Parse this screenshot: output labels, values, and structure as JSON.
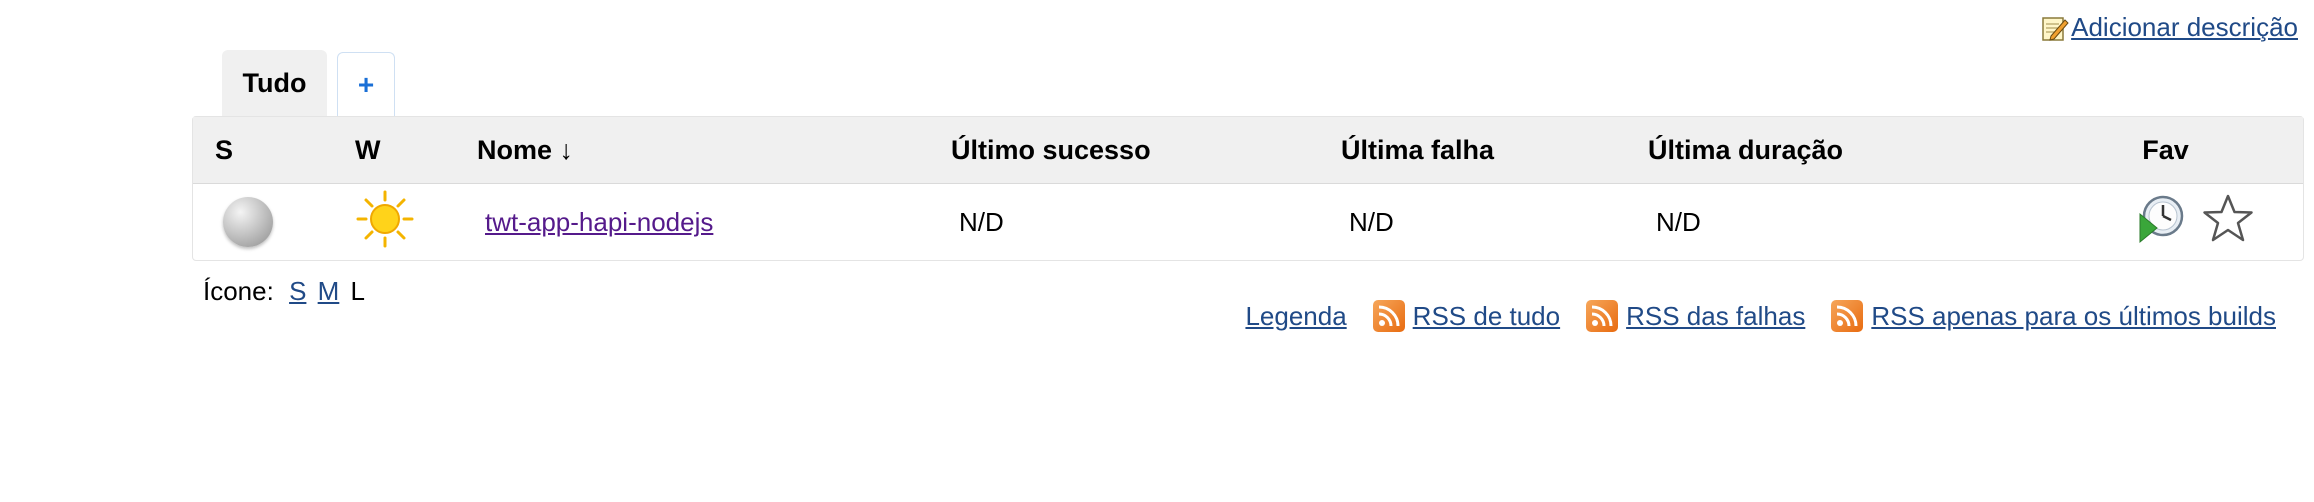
{
  "header": {
    "add_description_label": "Adicionar descrição",
    "add_description_icon": "edit-note-icon"
  },
  "tabs": {
    "active_label": "Tudo",
    "add_label": "+"
  },
  "table": {
    "columns": {
      "s": "S",
      "w": "W",
      "name": "Nome ↓",
      "last_success": "Último sucesso",
      "last_failure": "Última falha",
      "last_duration": "Última duração",
      "fav": "Fav"
    },
    "rows": [
      {
        "status_icon": "grey-ball-icon",
        "weather_icon": "sun-icon",
        "name": "twt-app-hapi-nodejs",
        "last_success": "N/D",
        "last_failure": "N/D",
        "last_duration": "N/D",
        "actions": [
          "schedule-build-icon",
          "favorite-star-icon"
        ]
      }
    ]
  },
  "icon_size": {
    "label": "Ícone:",
    "s": "S",
    "m": "M",
    "l": "L"
  },
  "footer": {
    "legend": "Legenda",
    "rss_all": "RSS de tudo",
    "rss_failures": "RSS das falhas",
    "rss_latest": "RSS apenas para os últimos builds"
  },
  "colors": {
    "link": "#204a87",
    "visited_link": "#551a8b",
    "header_bg": "#f0f0f0",
    "rss": "#e86b10"
  }
}
